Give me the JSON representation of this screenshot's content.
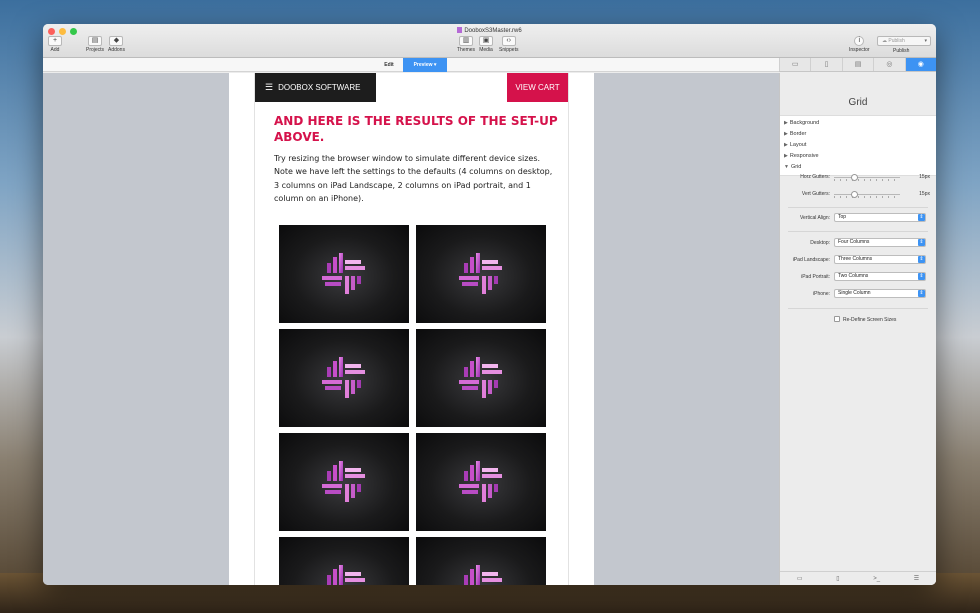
{
  "window": {
    "title": "DooboxS3Master.rw6"
  },
  "toolbar": {
    "add_label": "Add",
    "projects_label": "Projects",
    "addons_label": "Addons",
    "themes_label": "Themes",
    "media_label": "Media",
    "snippets_label": "Snippets",
    "inspector_label": "Inspector",
    "publish_button_label": "Publish",
    "publish_label": "Publish"
  },
  "modes": {
    "edit_label": "Edit",
    "preview_label": "Preview"
  },
  "page": {
    "brand": "DOOBOX SOFTWARE",
    "cart": "VIEW CART",
    "headline": "AND HERE IS THE RESULTS OF THE SET-UP ABOVE.",
    "body": "Try resizing the browser window to simulate different device sizes. Note we have left the settings to the defaults (4 columns on desktop, 3 columns on iPad Landscape, 2 columns on iPad portrait, and 1 column on an iPhone).",
    "tile_count": 8
  },
  "inspector": {
    "title": "Grid",
    "sections": [
      {
        "label": "Background",
        "expanded": false
      },
      {
        "label": "Border",
        "expanded": false
      },
      {
        "label": "Layout",
        "expanded": false
      },
      {
        "label": "Responsive",
        "expanded": false
      },
      {
        "label": "Grid",
        "expanded": true
      }
    ],
    "horz_gutters": {
      "label": "Horz Gutters:",
      "value": "15px",
      "level": 0.3
    },
    "vert_gutters": {
      "label": "Vert Gutters:",
      "value": "15px",
      "level": 0.3
    },
    "vertical_align": {
      "label": "Vertical Align:",
      "value": "Top"
    },
    "desktop": {
      "label": "Desktop:",
      "value": "Four Columns"
    },
    "ipad_landscape": {
      "label": "iPad Landscape:",
      "value": "Three Columns"
    },
    "ipad_portrait": {
      "label": "iPad Portrait:",
      "value": "Two Columns"
    },
    "iphone": {
      "label": "iPhone:",
      "value": "Single Column"
    },
    "redefine_label": "Re-Define Screen Sizes"
  },
  "colors": {
    "accent": "#d5124b",
    "selection": "#3d93f3",
    "brand_bar": "#1d1d1d"
  }
}
